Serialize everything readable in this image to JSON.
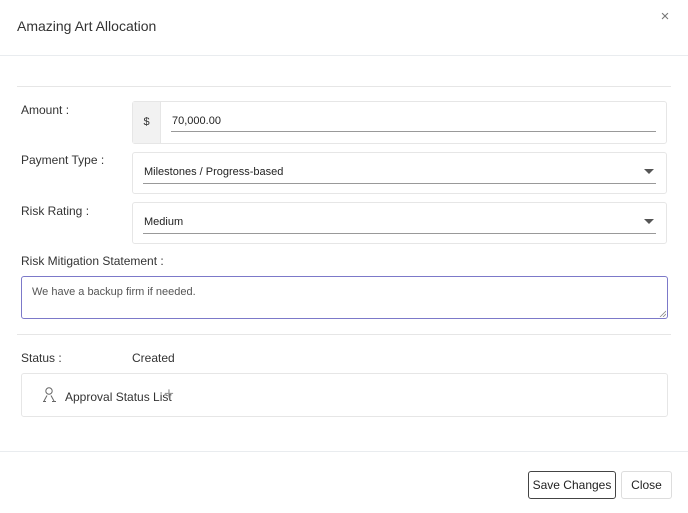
{
  "modal": {
    "title": "Amazing Art Allocation",
    "close_glyph": "×"
  },
  "form": {
    "amount": {
      "label": "Amount :",
      "currency_symbol": "$",
      "value": "70,000.00"
    },
    "payment_type": {
      "label": "Payment Type :",
      "selected": "Milestones / Progress-based"
    },
    "risk_rating": {
      "label": "Risk Rating :",
      "selected": "Medium"
    },
    "risk_mitigation": {
      "label": "Risk Mitigation Statement :",
      "value": "We have a backup firm if needed."
    },
    "status": {
      "label": "Status :",
      "value": "Created"
    },
    "approval": {
      "label": "Approval Status List",
      "icon": "user-icon",
      "add_glyph": "+"
    }
  },
  "footer": {
    "save_label": "Save Changes",
    "close_label": "Close"
  },
  "colors": {
    "focus_border": "#7c79c9",
    "divider": "#e6e6e6"
  }
}
